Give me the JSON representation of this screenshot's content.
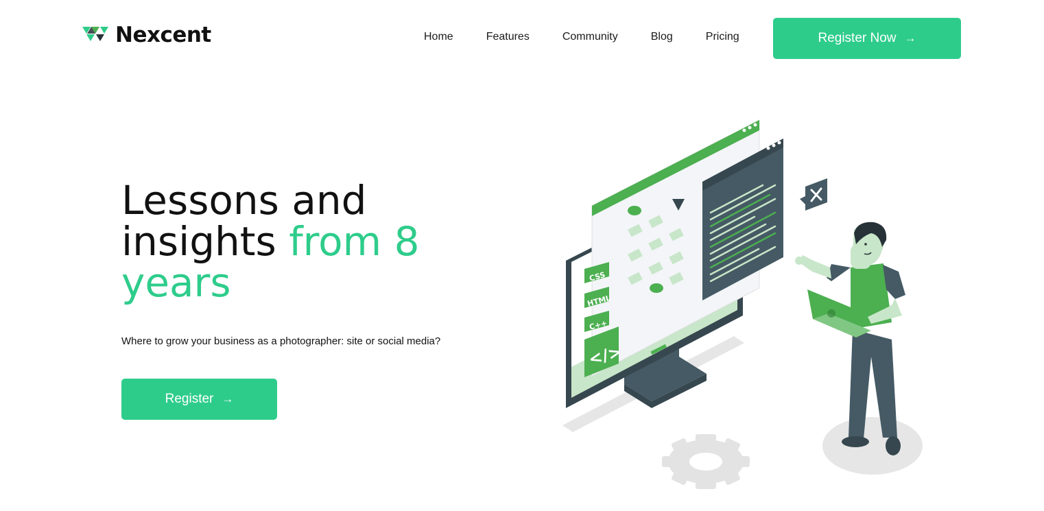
{
  "brand": {
    "name": "Nexcent",
    "logo_icon": "triangle-logo-icon",
    "accent_color": "#2ecc8b",
    "dark_color": "#455a64",
    "light_green": "#c8e6c9",
    "mid_green": "#4caf50"
  },
  "nav": {
    "items": [
      {
        "label": "Home"
      },
      {
        "label": "Features"
      },
      {
        "label": "Community"
      },
      {
        "label": "Blog"
      },
      {
        "label": "Pricing"
      }
    ]
  },
  "header_cta": {
    "label": "Register Now",
    "arrow": "→"
  },
  "hero": {
    "title_part1": "Lessons and insights ",
    "title_accent": "from 8 years",
    "subtitle": "Where to grow your business as a photographer: site or social media?",
    "cta": {
      "label": "Register",
      "arrow": "→"
    }
  },
  "illustration": {
    "description_icon": "developer-illustration",
    "code_tags": [
      "CSS",
      "HTML",
      "C++"
    ],
    "code_icon_label": "</>"
  }
}
